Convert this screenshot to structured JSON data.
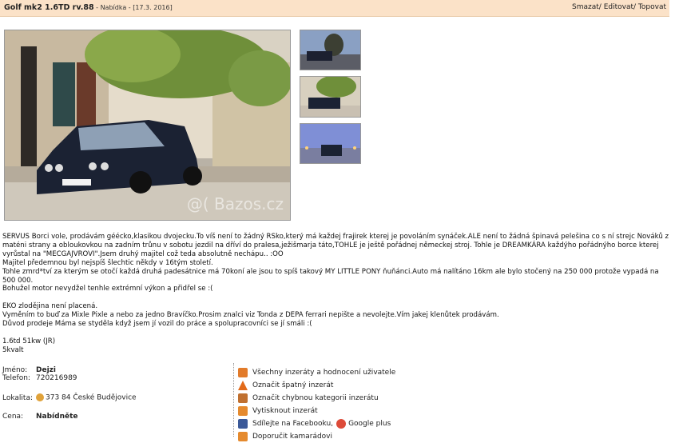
{
  "header": {
    "title": "Golf mk2 1.6TD rv.88",
    "category": " - Nabídka - ",
    "date": "[17.3. 2016]",
    "actions_delete": "Smazat",
    "actions_edit": "Editovat",
    "actions_top": "Topovat"
  },
  "photo": {
    "watermark": "@( Bazos.cz"
  },
  "description": [
    "SERVUS Borci vole, prodávám géécko,klasikou dvojecku.To víš není to žádný RSko,který má každej frajirek kterej je povoláním synáček.ALE není to žádná špinavá pelešina co s ní strejc Nováků z maténi strany a obloukovkou na zadním trůnu v sobotu jezdil na dříví do pralesa,ježišmarja táto,TOHLE je ještě pořádnej německej stroj. Tohle je DREAMKÁRA každýho pořádnýho borce kterej vyrůstal na \"MECGAJVROVI\".Jsem druhý majitel což teda absolutně nechápu.. :OO",
    "Majitel předemnou byl nejspíš šlechtic někdy v 16tým století.",
    "Tohle zmrd*tví za kterým se otočí každá druhá padesátnice má 70koní ale jsou to spíš takový MY LITTLE PONY ňuňánci.Auto má nalítáno 16km ale bylo stočený na 250 000 protože vypadá na 500 000.",
    "Bohužel motor nevydžel tenhle extrémní výkon a přidřel se :(",
    "",
    "EKO zlodějina není placená.",
    "Vyměním to buď za Mixle Pixle a nebo za jedno Bravíčko.Prosim znalci viz Tonda z DEPA ferrari nepište a nevolejte.Vím jakej klenůtek prodávám.",
    "Důvod prodeje Máma se styděla když jsem jí vozil do práce a spolupracovníci se jí smáli :(",
    "",
    "1.6td 51kw (JR)",
    "5kvalt"
  ],
  "seller": {
    "name_label": "Jméno:",
    "name": "Dejzi",
    "phone_label": "Telefon:",
    "phone": "720216989",
    "location_label": "Lokalita:",
    "location": "373 84 České Budějovice",
    "price_label": "Cena:",
    "price": "Nabídněte"
  },
  "links": {
    "all_ads": "Všechny inzeráty a hodnocení uživatele",
    "report_bad": "Označit špatný inzerát",
    "report_category": "Označit chybnou kategorii inzerátu",
    "print": "Vytisknout inzerát",
    "share_facebook": "Sdílejte na Facebooku,",
    "google_plus": "Google plus",
    "recommend": "Doporučit kamarádovi"
  }
}
